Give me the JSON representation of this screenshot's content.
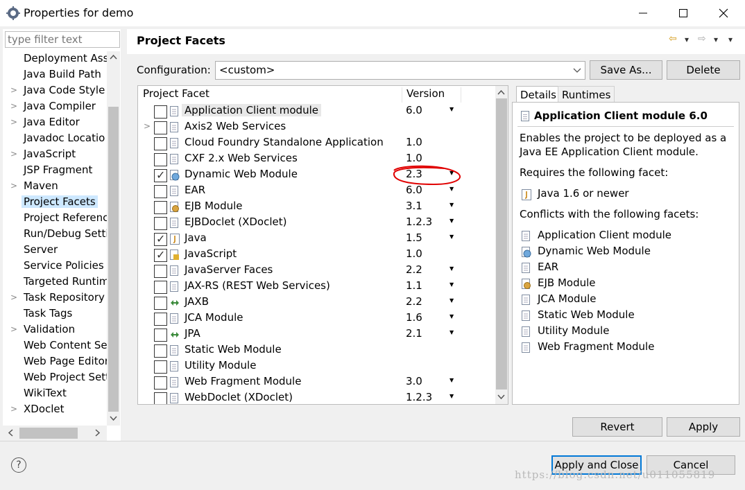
{
  "window": {
    "title": "Properties for demo",
    "minimize": "—",
    "maximize": "☐",
    "close": "✕"
  },
  "sidebar": {
    "filter_placeholder": "type filter text",
    "items": [
      {
        "label": "Deployment Ass",
        "arrow": ""
      },
      {
        "label": "Java Build Path",
        "arrow": ""
      },
      {
        "label": "Java Code Style",
        "arrow": ">"
      },
      {
        "label": "Java Compiler",
        "arrow": ">"
      },
      {
        "label": "Java Editor",
        "arrow": ">"
      },
      {
        "label": "Javadoc Locatio",
        "arrow": ""
      },
      {
        "label": "JavaScript",
        "arrow": ">"
      },
      {
        "label": "JSP Fragment",
        "arrow": ""
      },
      {
        "label": "Maven",
        "arrow": ">"
      },
      {
        "label": "Project Facets",
        "arrow": "",
        "selected": true
      },
      {
        "label": "Project Referenc",
        "arrow": ""
      },
      {
        "label": "Run/Debug Setti",
        "arrow": ""
      },
      {
        "label": "Server",
        "arrow": ""
      },
      {
        "label": "Service Policies",
        "arrow": ""
      },
      {
        "label": "Targeted Runtim",
        "arrow": ""
      },
      {
        "label": "Task Repository",
        "arrow": ">"
      },
      {
        "label": "Task Tags",
        "arrow": ""
      },
      {
        "label": "Validation",
        "arrow": ">"
      },
      {
        "label": "Web Content Se",
        "arrow": ""
      },
      {
        "label": "Web Page Editor",
        "arrow": ""
      },
      {
        "label": "Web Project Sett",
        "arrow": ""
      },
      {
        "label": "WikiText",
        "arrow": ""
      },
      {
        "label": "XDoclet",
        "arrow": ">"
      }
    ]
  },
  "header": {
    "title": "Project Facets",
    "back_icon": "⇦",
    "forward_icon": "⇨",
    "menu_icon": "▾"
  },
  "configuration": {
    "label": "Configuration:",
    "value": "<custom>",
    "save_as": "Save As...",
    "delete": "Delete"
  },
  "table": {
    "col_facet": "Project Facet",
    "col_version": "Version",
    "rows": [
      {
        "name": "Application Client module",
        "version": "6.0",
        "checked": false,
        "dropdown": true,
        "highlight": true,
        "expander": ""
      },
      {
        "name": "Axis2 Web Services",
        "version": "",
        "checked": false,
        "dropdown": false,
        "expander": ">"
      },
      {
        "name": "Cloud Foundry Standalone Application",
        "version": "1.0",
        "checked": false,
        "dropdown": false,
        "expander": ""
      },
      {
        "name": "CXF 2.x Web Services",
        "version": "1.0",
        "checked": false,
        "dropdown": false,
        "expander": ""
      },
      {
        "name": "Dynamic Web Module",
        "version": "2.3",
        "checked": true,
        "dropdown": true,
        "expander": ""
      },
      {
        "name": "EAR",
        "version": "6.0",
        "checked": false,
        "dropdown": true,
        "expander": ""
      },
      {
        "name": "EJB Module",
        "version": "3.1",
        "checked": false,
        "dropdown": true,
        "expander": ""
      },
      {
        "name": "EJBDoclet (XDoclet)",
        "version": "1.2.3",
        "checked": false,
        "dropdown": true,
        "expander": ""
      },
      {
        "name": "Java",
        "version": "1.5",
        "checked": true,
        "dropdown": true,
        "expander": ""
      },
      {
        "name": "JavaScript",
        "version": "1.0",
        "checked": true,
        "dropdown": false,
        "expander": ""
      },
      {
        "name": "JavaServer Faces",
        "version": "2.2",
        "checked": false,
        "dropdown": true,
        "expander": ""
      },
      {
        "name": "JAX-RS (REST Web Services)",
        "version": "1.1",
        "checked": false,
        "dropdown": true,
        "expander": ""
      },
      {
        "name": "JAXB",
        "version": "2.2",
        "checked": false,
        "dropdown": true,
        "expander": ""
      },
      {
        "name": "JCA Module",
        "version": "1.6",
        "checked": false,
        "dropdown": true,
        "expander": ""
      },
      {
        "name": "JPA",
        "version": "2.1",
        "checked": false,
        "dropdown": true,
        "expander": ""
      },
      {
        "name": "Static Web Module",
        "version": "",
        "checked": false,
        "dropdown": false,
        "expander": ""
      },
      {
        "name": "Utility Module",
        "version": "",
        "checked": false,
        "dropdown": false,
        "expander": ""
      },
      {
        "name": "Web Fragment Module",
        "version": "3.0",
        "checked": false,
        "dropdown": true,
        "expander": ""
      },
      {
        "name": "WebDoclet (XDoclet)",
        "version": "1.2.3",
        "checked": false,
        "dropdown": true,
        "expander": ""
      }
    ]
  },
  "details": {
    "tab_details": "Details",
    "tab_runtimes": "Runtimes",
    "title": "Application Client module 6.0",
    "description_line1": "Enables the project to be deployed as a",
    "description_line2": "Java EE Application Client module.",
    "requires_label": "Requires the following facet:",
    "requires": [
      "Java 1.6 or newer"
    ],
    "conflicts_label": "Conflicts with the following facets:",
    "conflicts": [
      "Application Client module",
      "Dynamic Web Module",
      "EAR",
      "EJB Module",
      "JCA Module",
      "Static Web Module",
      "Utility Module",
      "Web Fragment Module"
    ]
  },
  "buttons": {
    "revert": "Revert",
    "apply": "Apply",
    "apply_and_close": "Apply and Close",
    "cancel": "Cancel",
    "help": "?"
  },
  "watermark": "https://blog.csdn.net/u011055819",
  "colors": {
    "selection": "#cde8ff",
    "default_button_border": "#0078d7",
    "annotation": "#e00000"
  }
}
